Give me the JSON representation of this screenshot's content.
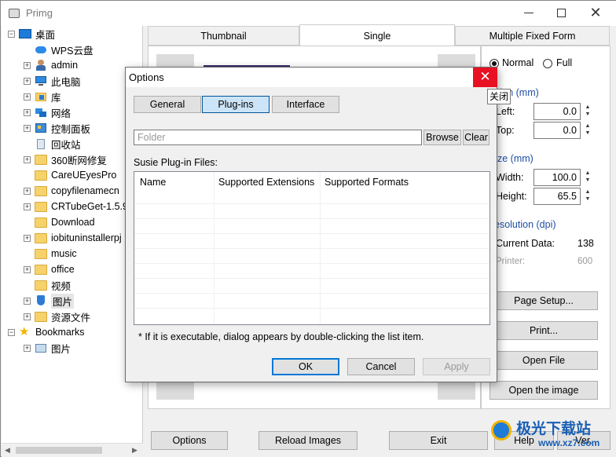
{
  "app": {
    "title": "Primg"
  },
  "tree": {
    "root": "桌面",
    "items": [
      "WPS云盘",
      "admin",
      "此电脑",
      "库",
      "网络",
      "控制面板",
      "回收站",
      "360断网修复",
      "CareUEyesPro",
      "copyfilenamecn",
      "CRTubeGet-1.5.9",
      "Download",
      "iobituninstallerpj",
      "music",
      "office",
      "视频",
      "图片",
      "资源文件"
    ],
    "bookmarks": "Bookmarks",
    "bookmark_items": [
      "图片"
    ]
  },
  "tabs": [
    "Thumbnail",
    "Single",
    "Multiple Fixed Form"
  ],
  "right_panel": {
    "normal": "Normal",
    "full": "Full",
    "position_label": "tion (mm)",
    "left_label": "Left:",
    "top_label": "Top:",
    "left_value": "0.0",
    "top_value": "0.0",
    "size_label": "ze (mm)",
    "width_label": "Width:",
    "height_label": "Height:",
    "width_value": "100.0",
    "height_value": "65.5",
    "resolution_label": "esolution (dpi)",
    "current_label": "Current Data:",
    "current_value": "138",
    "printer_label": "Printer:",
    "printer_value": "600",
    "page_setup": "Page Setup...",
    "print": "Print...",
    "open_file": "Open File",
    "open_image": "Open the image"
  },
  "bottom_bar": {
    "options": "Options",
    "reload": "Reload Images",
    "exit": "Exit",
    "help": "Help",
    "ver": "Ver."
  },
  "dialog": {
    "title": "Options",
    "close_tooltip": "关闭",
    "tabs": [
      "General",
      "Plug-ins",
      "Interface"
    ],
    "folder_placeholder": "Folder",
    "browse": "Browse",
    "clear": "Clear",
    "plugin_files_label": "Susie Plug-in Files:",
    "columns": [
      "Name",
      "Supported Extensions",
      "Supported Formats"
    ],
    "note": "* If it is executable, dialog appears by double-clicking the list item.",
    "ok": "OK",
    "cancel": "Cancel",
    "apply": "Apply"
  },
  "watermark": {
    "text": "极光下载站",
    "url": "www.xz7.com"
  },
  "colors": {
    "accent": "#0078d7",
    "close_red": "#e81123",
    "selected_tab": "#cce4f7"
  }
}
